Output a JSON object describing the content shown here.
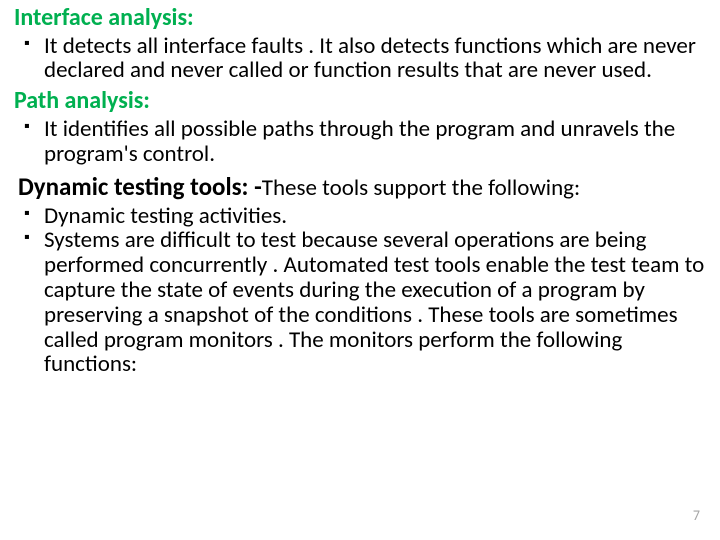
{
  "sections": {
    "interface": {
      "heading": "Interface analysis:",
      "items": [
        "It detects all interface faults . It also detects functions which are never declared and never called or function results that are never used."
      ]
    },
    "path": {
      "heading": "Path analysis:",
      "items": [
        "It identifies all possible paths through the program and unravels the program's control."
      ]
    },
    "dynamic": {
      "heading": "Dynamic testing tools: -",
      "tail": "These tools support the following:",
      "items": [
        "Dynamic testing activities.",
        "Systems are difficult to test because several operations are being performed concurrently . Automated test tools enable the test team to capture the state of events during the execution of a program by preserving a snapshot of the conditions . These tools are sometimes called program monitors . The monitors perform the following functions:"
      ]
    }
  },
  "page_number": "7"
}
